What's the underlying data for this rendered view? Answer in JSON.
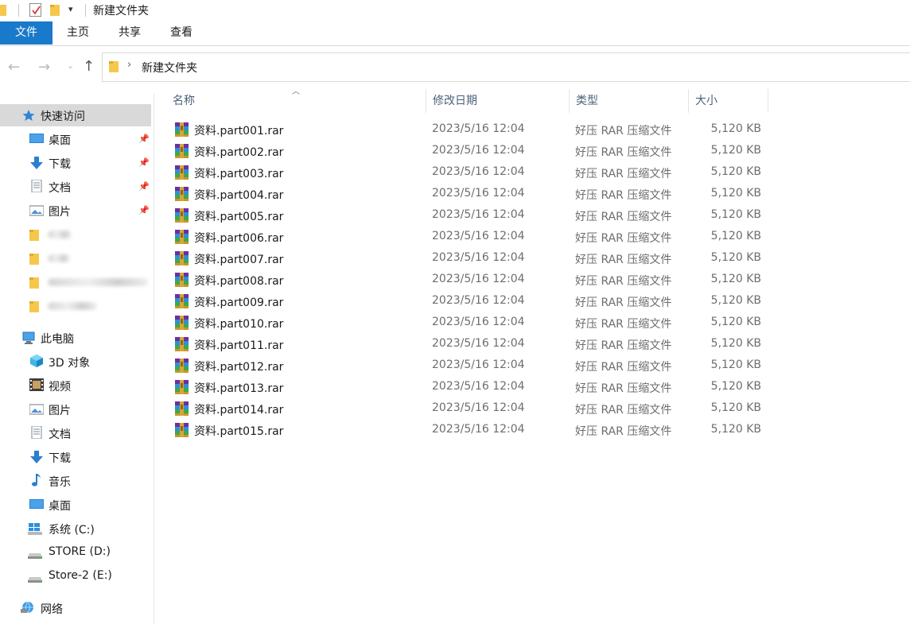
{
  "window": {
    "title": "新建文件夹"
  },
  "ribbon": {
    "tabs": [
      {
        "label": "文件"
      },
      {
        "label": "主页"
      },
      {
        "label": "共享"
      },
      {
        "label": "查看"
      }
    ]
  },
  "address": {
    "breadcrumb": "新建文件夹"
  },
  "sidebar": {
    "quick_access": "快速访问",
    "pinned": [
      {
        "label": "桌面",
        "icon": "desktop-icon"
      },
      {
        "label": "下载",
        "icon": "download-icon"
      },
      {
        "label": "文档",
        "icon": "document-icon"
      },
      {
        "label": "图片",
        "icon": "picture-icon"
      }
    ],
    "this_pc": "此电脑",
    "pc_items": [
      {
        "label": "3D 对象",
        "icon": "3d-objects-icon"
      },
      {
        "label": "视频",
        "icon": "video-icon"
      },
      {
        "label": "图片",
        "icon": "picture-icon"
      },
      {
        "label": "文档",
        "icon": "document-icon"
      },
      {
        "label": "下载",
        "icon": "download-icon"
      },
      {
        "label": "音乐",
        "icon": "music-icon"
      },
      {
        "label": "桌面",
        "icon": "desktop-icon"
      },
      {
        "label": "系统 (C:)",
        "icon": "windows-drive-icon"
      },
      {
        "label": "STORE (D:)",
        "icon": "drive-icon"
      },
      {
        "label": "Store-2 (E:)",
        "icon": "drive-icon"
      }
    ],
    "network": "网络"
  },
  "columns": {
    "name": "名称",
    "date": "修改日期",
    "type": "类型",
    "size": "大小"
  },
  "files": [
    {
      "name": "资料.part001.rar",
      "date": "2023/5/16 12:04",
      "type": "好压 RAR 压缩文件",
      "size": "5,120 KB"
    },
    {
      "name": "资料.part002.rar",
      "date": "2023/5/16 12:04",
      "type": "好压 RAR 压缩文件",
      "size": "5,120 KB"
    },
    {
      "name": "资料.part003.rar",
      "date": "2023/5/16 12:04",
      "type": "好压 RAR 压缩文件",
      "size": "5,120 KB"
    },
    {
      "name": "资料.part004.rar",
      "date": "2023/5/16 12:04",
      "type": "好压 RAR 压缩文件",
      "size": "5,120 KB"
    },
    {
      "name": "资料.part005.rar",
      "date": "2023/5/16 12:04",
      "type": "好压 RAR 压缩文件",
      "size": "5,120 KB"
    },
    {
      "name": "资料.part006.rar",
      "date": "2023/5/16 12:04",
      "type": "好压 RAR 压缩文件",
      "size": "5,120 KB"
    },
    {
      "name": "资料.part007.rar",
      "date": "2023/5/16 12:04",
      "type": "好压 RAR 压缩文件",
      "size": "5,120 KB"
    },
    {
      "name": "资料.part008.rar",
      "date": "2023/5/16 12:04",
      "type": "好压 RAR 压缩文件",
      "size": "5,120 KB"
    },
    {
      "name": "资料.part009.rar",
      "date": "2023/5/16 12:04",
      "type": "好压 RAR 压缩文件",
      "size": "5,120 KB"
    },
    {
      "name": "资料.part010.rar",
      "date": "2023/5/16 12:04",
      "type": "好压 RAR 压缩文件",
      "size": "5,120 KB"
    },
    {
      "name": "资料.part011.rar",
      "date": "2023/5/16 12:04",
      "type": "好压 RAR 压缩文件",
      "size": "5,120 KB"
    },
    {
      "name": "资料.part012.rar",
      "date": "2023/5/16 12:04",
      "type": "好压 RAR 压缩文件",
      "size": "5,120 KB"
    },
    {
      "name": "资料.part013.rar",
      "date": "2023/5/16 12:04",
      "type": "好压 RAR 压缩文件",
      "size": "5,120 KB"
    },
    {
      "name": "资料.part014.rar",
      "date": "2023/5/16 12:04",
      "type": "好压 RAR 压缩文件",
      "size": "5,120 KB"
    },
    {
      "name": "资料.part015.rar",
      "date": "2023/5/16 12:04",
      "type": "好压 RAR 压缩文件",
      "size": "5,120 KB"
    }
  ],
  "colors": {
    "accent": "#1979ca",
    "header_text": "#4c607a",
    "selected_bg": "#d9d9d9",
    "folder": "#f5c84c"
  }
}
